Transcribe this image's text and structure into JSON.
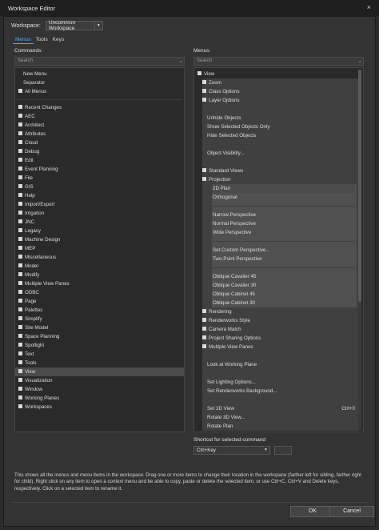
{
  "window": {
    "title": "Workspace Editor",
    "close_glyph": "×"
  },
  "workspace": {
    "label": "Workspace:",
    "selected": "Uncommon Workspace"
  },
  "tabs": [
    {
      "label": "Menus",
      "active": true
    },
    {
      "label": "Tools",
      "active": false
    },
    {
      "label": "Keys",
      "active": false
    }
  ],
  "commands": {
    "label": "Commands:",
    "search_placeholder": "Search",
    "top_items": [
      {
        "label": "New Menu",
        "expandable": false
      },
      {
        "label": "Separator",
        "expandable": false
      },
      {
        "label": "All Menus",
        "expandable": true
      }
    ],
    "items": [
      {
        "label": "Recent Changes"
      },
      {
        "label": "AEC"
      },
      {
        "label": "Architect"
      },
      {
        "label": "Attributes"
      },
      {
        "label": "Cloud"
      },
      {
        "label": "Debug"
      },
      {
        "label": "Edit"
      },
      {
        "label": "Event Planning"
      },
      {
        "label": "File"
      },
      {
        "label": "GIS"
      },
      {
        "label": "Help"
      },
      {
        "label": "Import/Export"
      },
      {
        "label": "Irrigation"
      },
      {
        "label": "JNC"
      },
      {
        "label": "Legacy"
      },
      {
        "label": "Machine Design"
      },
      {
        "label": "MEP"
      },
      {
        "label": "Miscellaneous"
      },
      {
        "label": "Model"
      },
      {
        "label": "Modify"
      },
      {
        "label": "Multiple View Panes"
      },
      {
        "label": "ODBC"
      },
      {
        "label": "Page"
      },
      {
        "label": "Palettes"
      },
      {
        "label": "Simplify"
      },
      {
        "label": "Site Model"
      },
      {
        "label": "Space Planning"
      },
      {
        "label": "Spotlight"
      },
      {
        "label": "Text"
      },
      {
        "label": "Tools"
      },
      {
        "label": "View",
        "selected": true
      },
      {
        "label": "Visualization"
      },
      {
        "label": "Window"
      },
      {
        "label": "Working Planes"
      },
      {
        "label": "Workspaces"
      }
    ]
  },
  "menus": {
    "label": "Menus:",
    "search_placeholder": "Search",
    "root": "View",
    "items": [
      {
        "label": "Zoom",
        "level": 1,
        "expandable": true
      },
      {
        "label": "Class Options",
        "level": 1,
        "expandable": true
      },
      {
        "label": "Layer Options",
        "level": 1,
        "expandable": true
      },
      {
        "label": "",
        "level": 1,
        "separator": true
      },
      {
        "label": "Unhide Objects",
        "level": 1
      },
      {
        "label": "Show Selected Objects Only",
        "level": 1
      },
      {
        "label": "Hide Selected Objects",
        "level": 1
      },
      {
        "label": "",
        "level": 1,
        "separator": true
      },
      {
        "label": "Object Visibility...",
        "level": 1
      },
      {
        "label": "",
        "level": 1,
        "separator": true
      },
      {
        "label": "Standard Views",
        "level": 1,
        "expandable": true
      },
      {
        "label": "Projection",
        "level": 1,
        "expandable": true,
        "open": true
      },
      {
        "label": "2D Plan",
        "level": 2,
        "selected": true
      },
      {
        "label": "Orthogonal",
        "level": 2
      },
      {
        "label": "",
        "level": 2,
        "separator": true
      },
      {
        "label": "Narrow Perspective",
        "level": 2
      },
      {
        "label": "Normal Perspective",
        "level": 2
      },
      {
        "label": "Wide Perspective",
        "level": 2
      },
      {
        "label": "",
        "level": 2,
        "separator": true
      },
      {
        "label": "Set Custom Perspective...",
        "level": 2
      },
      {
        "label": "Two-Point Perspective",
        "level": 2
      },
      {
        "label": "",
        "level": 2,
        "separator": true
      },
      {
        "label": "Oblique Cavalier 45",
        "level": 2
      },
      {
        "label": "Oblique Cavalier 30",
        "level": 2
      },
      {
        "label": "Oblique Cabinet 45",
        "level": 2
      },
      {
        "label": "Oblique Cabinet 30",
        "level": 2
      },
      {
        "label": "Rendering",
        "level": 1,
        "expandable": true
      },
      {
        "label": "Renderworks Style",
        "level": 1,
        "expandable": true
      },
      {
        "label": "Camera Match",
        "level": 1,
        "expandable": true
      },
      {
        "label": "Project Sharing Options",
        "level": 1,
        "expandable": true
      },
      {
        "label": "Multiple View Panes",
        "level": 1,
        "expandable": true
      },
      {
        "label": "",
        "level": 1,
        "separator": true
      },
      {
        "label": "Look at Working Plane",
        "level": 1
      },
      {
        "label": "",
        "level": 1,
        "separator": true
      },
      {
        "label": "Set Lighting Options...",
        "level": 1
      },
      {
        "label": "Set Renderworks Background...",
        "level": 1
      },
      {
        "label": "",
        "level": 1,
        "separator": true
      },
      {
        "label": "Set 3D View",
        "level": 1,
        "shortcut": "Ctrl+0"
      },
      {
        "label": "Rotate 3D View...",
        "level": 1
      },
      {
        "label": "Rotate Plan",
        "level": 1
      }
    ]
  },
  "shortcut": {
    "label": "Shortcut for selected command",
    "value": "Ctrl+Key"
  },
  "help_text": "This shows all the menus and menu items in the workspace. Drag one or more items to change their location in the workspace (farther left for sibling, farther right for child). Right click on any item to open a context menu and be able to copy, paste or delete the selected item, or use Ctrl+C, Ctrl+V and Delete keys, respectively. Click on a selected item to rename it.",
  "buttons": {
    "ok": "OK",
    "cancel": "Cancel"
  }
}
